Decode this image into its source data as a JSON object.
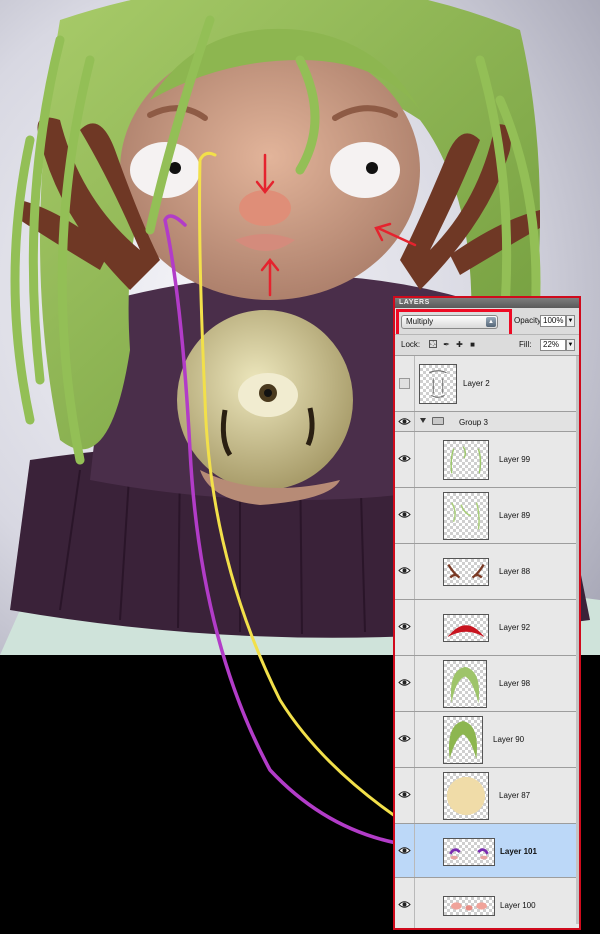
{
  "panel": {
    "title": "LAYERS",
    "blend_mode": "Multiply",
    "opacity_label": "Opacity:",
    "opacity_value": "100%",
    "lock_label": "Lock:",
    "fill_label": "Fill:",
    "fill_value": "22%",
    "layers": [
      {
        "name": "Layer 2",
        "visible": false,
        "selected": false,
        "in_group": false
      },
      {
        "name": "Group 3",
        "visible": true,
        "selected": false,
        "is_group": true
      },
      {
        "name": "Layer 99",
        "visible": true,
        "selected": false,
        "in_group": true
      },
      {
        "name": "Layer 89",
        "visible": true,
        "selected": false,
        "in_group": true
      },
      {
        "name": "Layer 88",
        "visible": true,
        "selected": false,
        "in_group": true
      },
      {
        "name": "Layer 92",
        "visible": true,
        "selected": false,
        "in_group": true
      },
      {
        "name": "Layer 98",
        "visible": true,
        "selected": false,
        "in_group": true
      },
      {
        "name": "Layer 90",
        "visible": true,
        "selected": false,
        "in_group": true
      },
      {
        "name": "Layer 87",
        "visible": true,
        "selected": false,
        "in_group": true
      },
      {
        "name": "Layer 101",
        "visible": true,
        "selected": true,
        "in_group": true
      },
      {
        "name": "Layer 100",
        "visible": true,
        "selected": false,
        "in_group": true
      }
    ]
  },
  "colors": {
    "highlight_box": "#ee0a24",
    "purple_arrow": "#b23cc8",
    "yellow_arrow": "#f2e04a",
    "red_arrow": "#e5232e",
    "selected_row": "#bcd8f8"
  },
  "icons": [
    "eye-icon",
    "folder-icon",
    "disclosure-triangle-icon",
    "lock-transparency-icon",
    "lock-brush-icon",
    "lock-move-icon",
    "lock-all-icon",
    "dropdown-arrow-icon"
  ]
}
